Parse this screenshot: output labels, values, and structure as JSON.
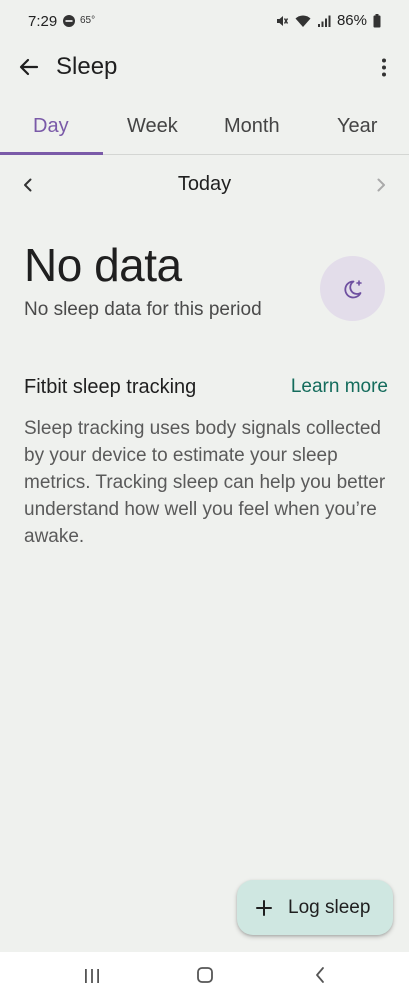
{
  "status_bar": {
    "time": "7:29",
    "temperature": "65°",
    "battery": "86%",
    "icons": [
      "do-not-disturb-icon",
      "mute-icon",
      "wifi-icon",
      "signal-icon",
      "battery-icon"
    ]
  },
  "app_bar": {
    "title": "Sleep",
    "back_icon": "arrow-left-icon",
    "menu_icon": "more-vert-icon"
  },
  "tabs": [
    {
      "label": "Day",
      "active": true
    },
    {
      "label": "Week",
      "active": false
    },
    {
      "label": "Month",
      "active": false
    },
    {
      "label": "Year",
      "active": false
    }
  ],
  "date_nav": {
    "label": "Today",
    "prev_icon": "chevron-left-icon",
    "next_icon": "chevron-right-icon"
  },
  "summary": {
    "title": "No data",
    "subtitle": "No sleep data for this period",
    "icon": "moon-sparkle-icon"
  },
  "info": {
    "title": "Fitbit sleep tracking",
    "link": "Learn more",
    "body": "Sleep tracking uses body signals collected by your device to estimate your sleep metrics. Tracking sleep can help you better understand how well you feel when you’re awake."
  },
  "fab": {
    "label": "Log sleep",
    "icon": "plus-icon"
  },
  "nav_bar": {
    "icons": [
      "recents-icon",
      "home-icon",
      "back-icon"
    ]
  },
  "colors": {
    "background": "#eff1ee",
    "accent": "#7a5aa8",
    "link": "#146c5c",
    "fab": "#cfe7e1",
    "moon_badge": "#e3ddea"
  }
}
